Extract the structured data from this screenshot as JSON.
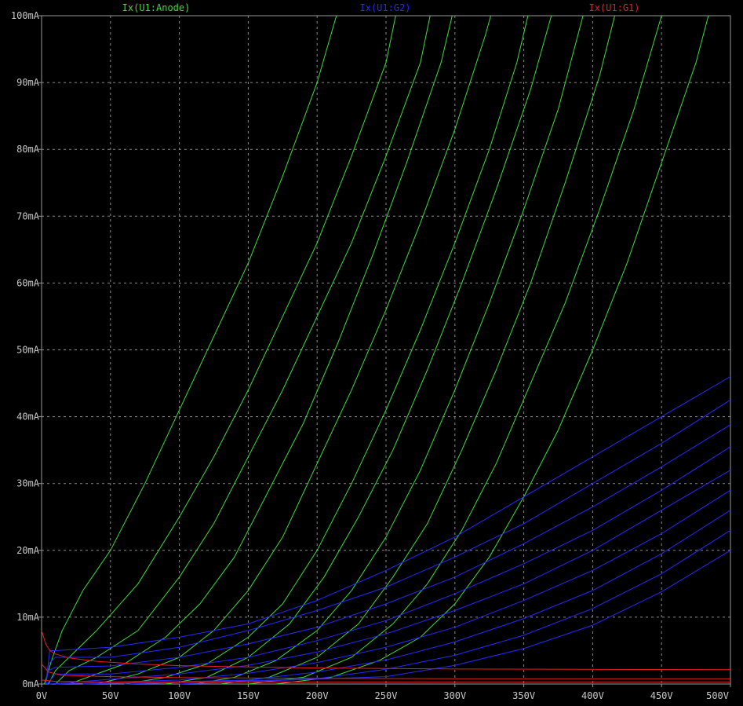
{
  "chart_data": {
    "type": "line",
    "title": "",
    "xlabel": "",
    "ylabel": "",
    "xlim": [
      0,
      500
    ],
    "ylim": [
      0,
      100
    ],
    "grid": true,
    "legend_position": "top",
    "x_ticks": [
      "0V",
      "50V",
      "100V",
      "150V",
      "200V",
      "250V",
      "300V",
      "350V",
      "400V",
      "450V",
      "500V"
    ],
    "y_ticks": [
      "0mA",
      "10mA",
      "20mA",
      "30mA",
      "40mA",
      "50mA",
      "60mA",
      "70mA",
      "80mA",
      "90mA",
      "100mA"
    ],
    "legend": [
      {
        "label": "Ix(U1:Anode)",
        "color": "#3cdc3c"
      },
      {
        "label": "Ix(U1:G2)",
        "color": "#2828ff"
      },
      {
        "label": "Ix(U1:G1)",
        "color": "#e61e1e"
      }
    ],
    "series": [
      {
        "group": "anode",
        "color": "#3cdc3c",
        "points": [
          [
            2,
            0
          ],
          [
            8,
            4
          ],
          [
            15,
            8
          ],
          [
            30,
            14
          ],
          [
            50,
            20
          ],
          [
            75,
            30
          ],
          [
            100,
            41
          ],
          [
            125,
            52
          ],
          [
            150,
            63
          ],
          [
            175,
            76
          ],
          [
            200,
            90
          ],
          [
            214,
            100
          ]
        ]
      },
      {
        "group": "anode",
        "color": "#3cdc3c",
        "points": [
          [
            5,
            0
          ],
          [
            10,
            2
          ],
          [
            20,
            4
          ],
          [
            40,
            8
          ],
          [
            70,
            15
          ],
          [
            100,
            25
          ],
          [
            125,
            34
          ],
          [
            150,
            44
          ],
          [
            175,
            55
          ],
          [
            200,
            66
          ],
          [
            225,
            79
          ],
          [
            250,
            93
          ],
          [
            257,
            100
          ]
        ]
      },
      {
        "group": "anode",
        "color": "#3cdc3c",
        "points": [
          [
            10,
            0
          ],
          [
            20,
            2
          ],
          [
            40,
            4
          ],
          [
            70,
            8
          ],
          [
            100,
            16
          ],
          [
            125,
            24
          ],
          [
            150,
            34
          ],
          [
            175,
            44
          ],
          [
            200,
            55
          ],
          [
            225,
            66
          ],
          [
            250,
            79
          ],
          [
            275,
            93
          ],
          [
            282,
            100
          ]
        ]
      },
      {
        "group": "anode",
        "color": "#3cdc3c",
        "points": [
          [
            20,
            0
          ],
          [
            40,
            1.5
          ],
          [
            60,
            3
          ],
          [
            90,
            7
          ],
          [
            115,
            12
          ],
          [
            140,
            19
          ],
          [
            165,
            29
          ],
          [
            190,
            39
          ],
          [
            215,
            51
          ],
          [
            240,
            64
          ],
          [
            265,
            78
          ],
          [
            290,
            93
          ],
          [
            298,
            100
          ]
        ]
      },
      {
        "group": "anode",
        "color": "#3cdc3c",
        "points": [
          [
            40,
            0
          ],
          [
            70,
            1.5
          ],
          [
            100,
            4
          ],
          [
            125,
            8
          ],
          [
            150,
            14
          ],
          [
            175,
            22
          ],
          [
            200,
            33
          ],
          [
            225,
            44
          ],
          [
            250,
            56
          ],
          [
            275,
            69
          ],
          [
            300,
            83
          ],
          [
            322,
            97
          ],
          [
            326,
            100
          ]
        ]
      },
      {
        "group": "anode",
        "color": "#3cdc3c",
        "points": [
          [
            60,
            0
          ],
          [
            90,
            1
          ],
          [
            120,
            3
          ],
          [
            150,
            7
          ],
          [
            175,
            12
          ],
          [
            200,
            20
          ],
          [
            225,
            30
          ],
          [
            250,
            41
          ],
          [
            275,
            53
          ],
          [
            300,
            66
          ],
          [
            325,
            80
          ],
          [
            345,
            93
          ],
          [
            353,
            100
          ]
        ]
      },
      {
        "group": "anode",
        "color": "#3cdc3c",
        "points": [
          [
            90,
            0
          ],
          [
            120,
            1
          ],
          [
            150,
            4
          ],
          [
            180,
            9
          ],
          [
            205,
            16
          ],
          [
            230,
            25
          ],
          [
            255,
            35
          ],
          [
            280,
            47
          ],
          [
            305,
            60
          ],
          [
            330,
            74
          ],
          [
            355,
            89
          ],
          [
            370,
            100
          ]
        ]
      },
      {
        "group": "anode",
        "color": "#3cdc3c",
        "points": [
          [
            110,
            0
          ],
          [
            140,
            1
          ],
          [
            170,
            3.5
          ],
          [
            200,
            8
          ],
          [
            225,
            14
          ],
          [
            250,
            22
          ],
          [
            275,
            32
          ],
          [
            300,
            44
          ],
          [
            325,
            57
          ],
          [
            350,
            71
          ],
          [
            375,
            86
          ],
          [
            393,
            100
          ]
        ]
      },
      {
        "group": "anode",
        "color": "#3cdc3c",
        "points": [
          [
            130,
            0
          ],
          [
            165,
            1
          ],
          [
            200,
            4
          ],
          [
            230,
            9
          ],
          [
            255,
            16
          ],
          [
            280,
            24
          ],
          [
            305,
            35
          ],
          [
            330,
            47
          ],
          [
            355,
            60
          ],
          [
            380,
            75
          ],
          [
            405,
            91
          ],
          [
            416,
            100
          ]
        ]
      },
      {
        "group": "anode",
        "color": "#3cdc3c",
        "points": [
          [
            150,
            0
          ],
          [
            190,
            1
          ],
          [
            225,
            4
          ],
          [
            255,
            9
          ],
          [
            280,
            15
          ],
          [
            305,
            23
          ],
          [
            330,
            33
          ],
          [
            355,
            45
          ],
          [
            380,
            57
          ],
          [
            405,
            71
          ],
          [
            430,
            86
          ],
          [
            450,
            100
          ]
        ]
      },
      {
        "group": "anode",
        "color": "#3cdc3c",
        "points": [
          [
            170,
            0
          ],
          [
            210,
            1
          ],
          [
            245,
            3.5
          ],
          [
            275,
            7
          ],
          [
            300,
            12
          ],
          [
            325,
            19
          ],
          [
            350,
            28
          ],
          [
            375,
            38
          ],
          [
            400,
            50
          ],
          [
            425,
            63
          ],
          [
            450,
            78
          ],
          [
            475,
            93
          ],
          [
            484,
            100
          ]
        ]
      },
      {
        "group": "g2",
        "color": "#2828ff",
        "points": [
          [
            3,
            0
          ],
          [
            6,
            5
          ],
          [
            10,
            5
          ],
          [
            50,
            5.5
          ],
          [
            100,
            7
          ],
          [
            150,
            9
          ],
          [
            200,
            12.5
          ],
          [
            250,
            17
          ],
          [
            300,
            22
          ],
          [
            350,
            28
          ],
          [
            400,
            34
          ],
          [
            450,
            40
          ],
          [
            500,
            46
          ]
        ]
      },
      {
        "group": "g2",
        "color": "#2828ff",
        "points": [
          [
            3,
            0
          ],
          [
            5,
            3
          ],
          [
            10,
            4
          ],
          [
            50,
            4
          ],
          [
            100,
            5.5
          ],
          [
            150,
            8
          ],
          [
            200,
            11
          ],
          [
            250,
            14.5
          ],
          [
            300,
            19
          ],
          [
            350,
            24
          ],
          [
            400,
            30
          ],
          [
            450,
            36
          ],
          [
            500,
            42.5
          ]
        ]
      },
      {
        "group": "g2",
        "color": "#2828ff",
        "points": [
          [
            3,
            0
          ],
          [
            5,
            2
          ],
          [
            10,
            2.5
          ],
          [
            50,
            2.7
          ],
          [
            100,
            4
          ],
          [
            150,
            6
          ],
          [
            200,
            8.5
          ],
          [
            250,
            12
          ],
          [
            300,
            16
          ],
          [
            350,
            21
          ],
          [
            400,
            26.5
          ],
          [
            450,
            32.5
          ],
          [
            500,
            38.8
          ]
        ]
      },
      {
        "group": "g2",
        "color": "#2828ff",
        "points": [
          [
            4,
            0
          ],
          [
            10,
            1.5
          ],
          [
            50,
            1.5
          ],
          [
            100,
            2.5
          ],
          [
            150,
            4
          ],
          [
            200,
            6.5
          ],
          [
            250,
            9.5
          ],
          [
            300,
            13.5
          ],
          [
            350,
            18
          ],
          [
            400,
            23
          ],
          [
            450,
            29
          ],
          [
            500,
            35.5
          ]
        ]
      },
      {
        "group": "g2",
        "color": "#2828ff",
        "points": [
          [
            5,
            0
          ],
          [
            50,
            0.7
          ],
          [
            100,
            1.5
          ],
          [
            150,
            2.8
          ],
          [
            200,
            4.8
          ],
          [
            250,
            7.5
          ],
          [
            300,
            11
          ],
          [
            350,
            15
          ],
          [
            400,
            20
          ],
          [
            450,
            26
          ],
          [
            500,
            32
          ]
        ]
      },
      {
        "group": "g2",
        "color": "#2828ff",
        "points": [
          [
            10,
            0
          ],
          [
            100,
            0.6
          ],
          [
            150,
            1.6
          ],
          [
            200,
            3.2
          ],
          [
            250,
            5.5
          ],
          [
            300,
            8.5
          ],
          [
            350,
            12.5
          ],
          [
            400,
            17
          ],
          [
            450,
            22.5
          ],
          [
            500,
            29
          ]
        ]
      },
      {
        "group": "g2",
        "color": "#2828ff",
        "points": [
          [
            30,
            0
          ],
          [
            150,
            0.6
          ],
          [
            200,
            1.8
          ],
          [
            250,
            3.6
          ],
          [
            300,
            6.3
          ],
          [
            350,
            9.8
          ],
          [
            400,
            14
          ],
          [
            450,
            19.5
          ],
          [
            500,
            26
          ]
        ]
      },
      {
        "group": "g2",
        "color": "#2828ff",
        "points": [
          [
            60,
            0
          ],
          [
            200,
            0.8
          ],
          [
            250,
            2.2
          ],
          [
            300,
            4.3
          ],
          [
            350,
            7.3
          ],
          [
            400,
            11.3
          ],
          [
            450,
            16.5
          ],
          [
            500,
            23
          ]
        ]
      },
      {
        "group": "g2",
        "color": "#2828ff",
        "points": [
          [
            100,
            0
          ],
          [
            250,
            1.1
          ],
          [
            300,
            2.8
          ],
          [
            350,
            5.3
          ],
          [
            400,
            8.8
          ],
          [
            450,
            13.8
          ],
          [
            500,
            20
          ]
        ]
      },
      {
        "group": "g1",
        "color": "#e61e1e",
        "points": [
          [
            0,
            8
          ],
          [
            3,
            6
          ],
          [
            6,
            5
          ],
          [
            10,
            4.5
          ],
          [
            20,
            3.9
          ],
          [
            40,
            3.4
          ],
          [
            70,
            3
          ],
          [
            100,
            2.75
          ],
          [
            150,
            2.55
          ],
          [
            200,
            2.4
          ],
          [
            300,
            2.25
          ],
          [
            400,
            2.2
          ],
          [
            500,
            2.15
          ]
        ]
      },
      {
        "group": "g1",
        "color": "#e61e1e",
        "points": [
          [
            0,
            3
          ],
          [
            5,
            1.8
          ],
          [
            15,
            1.3
          ],
          [
            50,
            1.1
          ],
          [
            100,
            0.95
          ],
          [
            200,
            0.85
          ],
          [
            300,
            0.8
          ],
          [
            500,
            0.8
          ]
        ]
      },
      {
        "group": "g1",
        "color": "#e61e1e",
        "points": [
          [
            0,
            0.6
          ],
          [
            10,
            0.4
          ],
          [
            50,
            0.3
          ],
          [
            500,
            0.3
          ]
        ]
      }
    ]
  }
}
